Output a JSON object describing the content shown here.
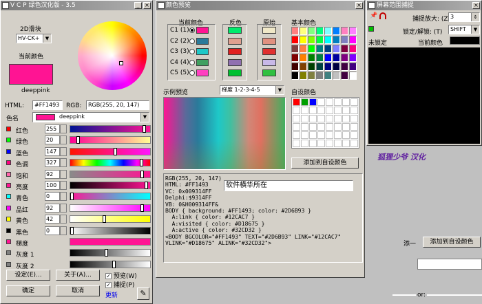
{
  "vcp": {
    "title": "V C P 绿色汉化版 - 3.5",
    "slider_2d_label": "2D滑块",
    "slider_2d_value": "HV-CK+",
    "current_color_label": "当前颜色",
    "current_color_name": "deeppink",
    "html_label": "HTML:",
    "html_value": "#FF1493",
    "rgb_label": "RGB:",
    "rgb_value": "RGB(255, 20, 147)",
    "color_name_label": "色名",
    "color_name_value": "deeppink",
    "rows": [
      {
        "label": "红色",
        "value": "255",
        "color": "#ff0000",
        "bar": "linear-gradient(90deg,#001493,#ff1493)",
        "pos": 0.95
      },
      {
        "label": "绿色",
        "value": "20",
        "color": "#00ff00",
        "bar": "linear-gradient(90deg,#ff0093,#ffff93)",
        "pos": 0.08
      },
      {
        "label": "蓝色",
        "value": "147",
        "color": "#0000ff",
        "bar": "linear-gradient(90deg,#ff1400,#ff14ff)",
        "pos": 0.57
      },
      {
        "label": "色调",
        "value": "327",
        "color": "#ff0080",
        "bar": "linear-gradient(90deg,#f00,#ff0,#0f0,#0ff,#00f,#f0f,#f00)",
        "pos": 0.91
      },
      {
        "label": "饱和",
        "value": "92",
        "color": "#ff66aa",
        "bar": "linear-gradient(90deg,#8a8a8a,#ff1493)",
        "pos": 0.92
      },
      {
        "label": "亮度",
        "value": "100",
        "color": "#ff1493",
        "bar": "linear-gradient(90deg,#000,#ff1493)",
        "pos": 0.97
      },
      {
        "label": "青色",
        "value": "0",
        "color": "#00ffff",
        "bar": "linear-gradient(90deg,#ff1493,#00ffff)",
        "pos": 0.0
      },
      {
        "label": "品红",
        "value": "92",
        "color": "#ff00ff",
        "bar": "linear-gradient(90deg,#ffffff,#ff00ff)",
        "pos": 0.92
      },
      {
        "label": "黄色",
        "value": "42",
        "color": "#ffff00",
        "bar": "linear-gradient(90deg,#ffffff,#ffff00)",
        "pos": 0.42
      },
      {
        "label": "黑色",
        "value": "0",
        "color": "#000000",
        "bar": "linear-gradient(90deg,#ffffff,#000000)",
        "pos": 0.0
      }
    ],
    "extra_rows": [
      {
        "label": "梯度",
        "color": "#ff1493",
        "bar": "linear-gradient(90deg,#ff1493,#ff1493)"
      },
      {
        "label": "灰度 1",
        "color": "#808080",
        "bar": "linear-gradient(90deg,#000,#fff)",
        "pos": 0.45
      },
      {
        "label": "灰度 2",
        "color": "#808080",
        "bar": "linear-gradient(90deg,#000,#fff)",
        "pos": 0.55
      }
    ],
    "settings_btn": "设定(E)...",
    "about_btn": "关于(A)...",
    "ok_btn": "确定",
    "cancel_btn": "取消",
    "preview_chk": "预览(W)",
    "capture_chk": "捕捉(P)",
    "update_link": "更新"
  },
  "preview": {
    "title": "颜色预览",
    "current_color_label": "当前颜色",
    "inverse_label": "反色",
    "original_label": "原始",
    "basic_label": "基本颜色",
    "slots": [
      "C1 (1)",
      "C2 (2)",
      "C3 (3)",
      "C4 (4)",
      "C5 (5)"
    ],
    "slot_colors": [
      "#ff1493",
      "#2a7a9a",
      "#1ec8c8",
      "#40a060",
      "#ff40c0"
    ],
    "inverse_colors": [
      "#00eb6c",
      "#e0a090",
      "#e02020",
      "#9070b0",
      "#00c030"
    ],
    "original_colors": [
      "#f0e8c8",
      "#e09080",
      "#e03030",
      "#c8b8e8",
      "#30c040"
    ],
    "sample_label": "示例预览",
    "gradient_select": "梯度 1-2-3-4-5",
    "custom_label": "自设颜色",
    "add_custom_btn": "添加到自设颜色",
    "code_lines": [
      "RGB(255, 20, 147)",
      "HTML: #FF1493",
      "VC: 0x009314FF",
      "Delphi:$9314FF",
      "VB: 0&H009314FF&",
      "",
      "BODY { background: #FF1493; color: #2D6B93 }",
      "  A:link { color: #12CAC7 }",
      "  A:visited { color: #D18675 }",
      "  A:active { color: #32CD32 }",
      "",
      "<BODY BGCOLOR=\"#FF1493\" TEXT=\"#2D6B93\" LINK=\"#12CAC7\"",
      "VLINK=\"#D18675\" ALINK=\"#32CD32\">"
    ],
    "watermark_text": "软件横华所在"
  },
  "capture": {
    "title": "屏幕范围捕捉",
    "zoom_label": "捕捉放大: (Z)",
    "zoom_value": "3",
    "lock_label": "锁定/解锁: (T)",
    "lock_value": "SHIFT",
    "unlocked_label": "未锁定",
    "current_color_label": "当前颜色",
    "credit": "狐狸少爷 汉化"
  },
  "stray": {
    "label": "添一",
    "add_btn": "添加到自设颜色",
    "bottom_text": "or:"
  },
  "basic_palette": [
    "#ff8080",
    "#ffff80",
    "#80ff80",
    "#00ff80",
    "#80ffff",
    "#0080ff",
    "#ff80c0",
    "#ff80ff",
    "#ff0000",
    "#ffff00",
    "#80ff00",
    "#00ff40",
    "#00ffff",
    "#0080c0",
    "#8080c0",
    "#ff00ff",
    "#804040",
    "#ff8040",
    "#00ff00",
    "#008080",
    "#004080",
    "#8080ff",
    "#800040",
    "#ff0080",
    "#800000",
    "#ff8000",
    "#008000",
    "#008040",
    "#0000ff",
    "#0000a0",
    "#800080",
    "#8000ff",
    "#400000",
    "#804000",
    "#004000",
    "#004040",
    "#000080",
    "#000040",
    "#400040",
    "#400080",
    "#000000",
    "#808000",
    "#808040",
    "#808080",
    "#408080",
    "#c0c0c0",
    "#400040",
    "#ffffff"
  ],
  "custom_palette": [
    "#ff0000",
    "#00a000",
    "#0000ff",
    "#ffffff"
  ]
}
